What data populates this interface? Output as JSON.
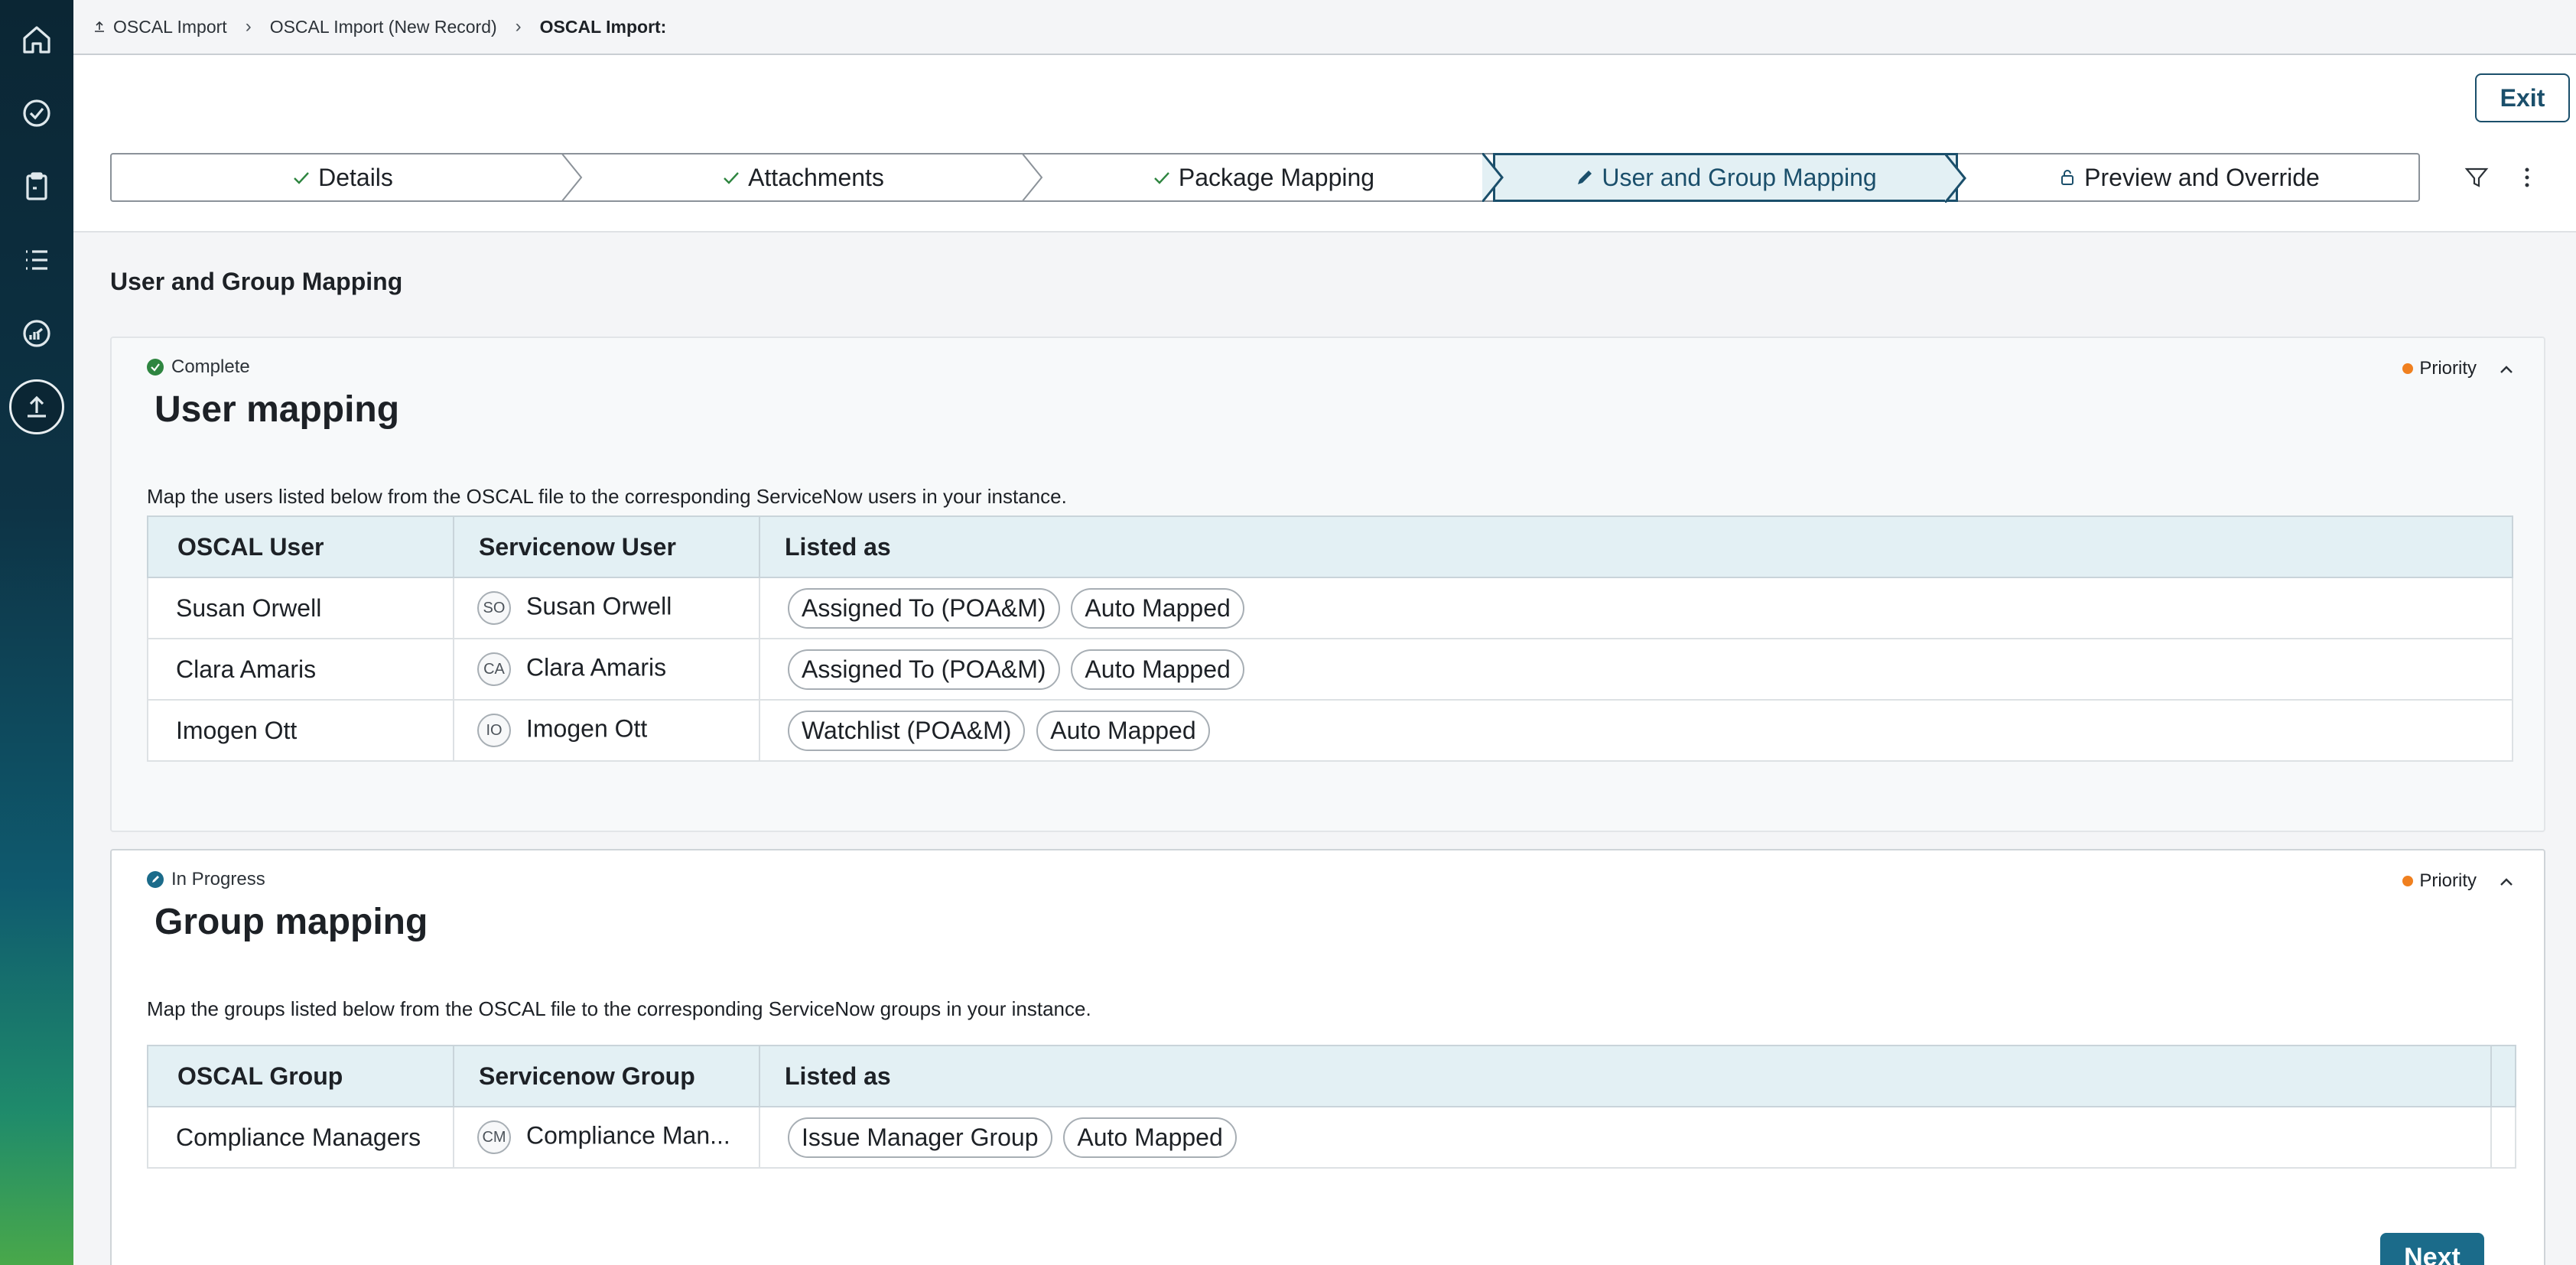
{
  "breadcrumb": {
    "items": [
      "OSCAL Import",
      "OSCAL Import (New Record)",
      "OSCAL Import:"
    ]
  },
  "header": {
    "exit_label": "Exit",
    "steps": [
      {
        "label": "Details",
        "state": "done"
      },
      {
        "label": "Attachments",
        "state": "done"
      },
      {
        "label": "Package Mapping",
        "state": "done"
      },
      {
        "label": "User and Group Mapping",
        "state": "active"
      },
      {
        "label": "Preview and Override",
        "state": "locked"
      }
    ]
  },
  "page": {
    "section_title": "User and Group Mapping",
    "next_label": "Next"
  },
  "user_mapping": {
    "status": "Complete",
    "status_color": "#2e8540",
    "priority": "Priority",
    "priority_color": "#f0801f",
    "title": "User mapping",
    "description": "Map the users listed below from the OSCAL file to the corresponding ServiceNow users in your instance.",
    "columns": [
      "OSCAL User",
      "Servicenow User",
      "Listed as"
    ],
    "rows": [
      {
        "oscal": "Susan Orwell",
        "initials": "SO",
        "servicenow": "Susan Orwell",
        "listed": [
          "Assigned To (POA&M)",
          "Auto Mapped"
        ]
      },
      {
        "oscal": "Clara Amaris",
        "initials": "CA",
        "servicenow": "Clara Amaris",
        "listed": [
          "Assigned To (POA&M)",
          "Auto Mapped"
        ]
      },
      {
        "oscal": "Imogen Ott",
        "initials": "IO",
        "servicenow": "Imogen Ott",
        "listed": [
          "Watchlist (POA&M)",
          "Auto Mapped"
        ]
      }
    ]
  },
  "group_mapping": {
    "status": "In Progress",
    "status_color": "#1b6b8a",
    "priority": "Priority",
    "priority_color": "#f0801f",
    "title": "Group mapping",
    "description": "Map the groups listed below from the OSCAL file to the corresponding ServiceNow groups in your instance.",
    "columns": [
      "OSCAL Group",
      "Servicenow Group",
      "Listed as"
    ],
    "rows": [
      {
        "oscal": "Compliance Managers",
        "initials": "CM",
        "servicenow": "Compliance Man...",
        "listed": [
          "Issue Manager Group",
          "Auto Mapped"
        ]
      }
    ]
  },
  "rail": {
    "icons": [
      "home-icon",
      "check-circle-icon",
      "clipboard-icon",
      "list-icon",
      "dashboard-icon",
      "upload-icon"
    ]
  }
}
